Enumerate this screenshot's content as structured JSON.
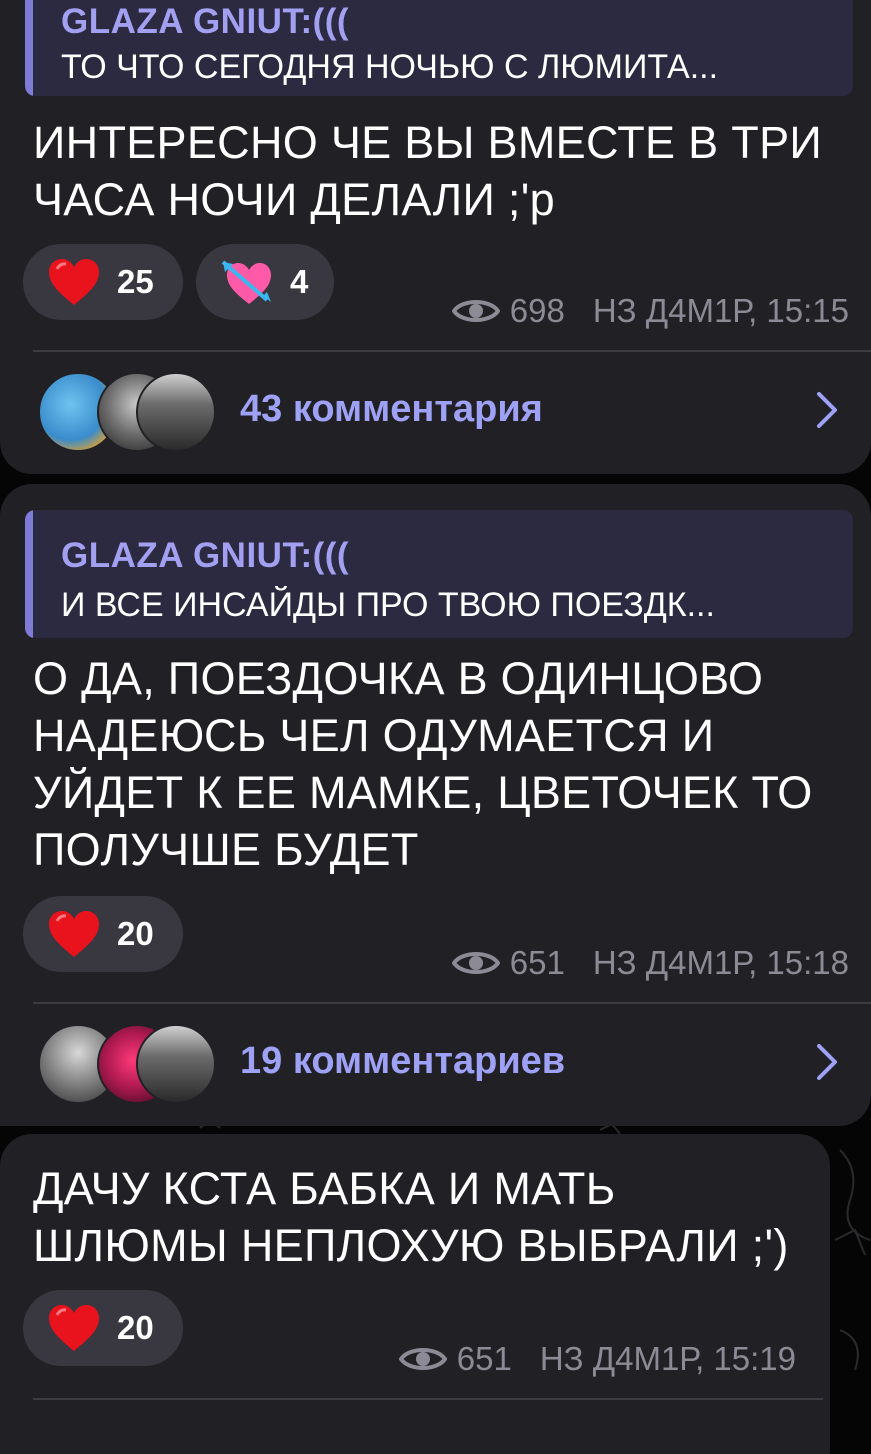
{
  "posts": [
    {
      "quote_author": "GLAZA GNIUT:(((",
      "quote_text": "ТО ЧТО СЕГОДНЯ НОЧЬЮ С ЛЮМИТА...",
      "text": "ИНТЕРЕСНО ЧЕ ВЫ ВМЕСТЕ В ТРИ\nЧАСА НОЧИ ДЕЛАЛИ ;'р",
      "reactions": [
        {
          "icon": "red-heart-icon",
          "count": "25"
        },
        {
          "icon": "heart-with-arrow-icon",
          "count": "4"
        }
      ],
      "views": "698",
      "author_time": "НЗ Д4М1Р, 15:15",
      "comments_label": "43 комментария"
    },
    {
      "quote_author": "GLAZA GNIUT:(((",
      "quote_text": "И ВСЕ ИНСАЙДЫ ПРО ТВОЮ ПОЕЗДК...",
      "text": "О ДА, ПОЕЗДОЧКА В ОДИНЦОВО\nНАДЕЮСЬ ЧЕЛ ОДУМАЕТСЯ И\nУЙДЕТ К ЕЕ МАМКЕ, ЦВЕТОЧЕК ТО\nПОЛУЧШЕ БУДЕТ",
      "reactions": [
        {
          "icon": "red-heart-icon",
          "count": "20"
        }
      ],
      "views": "651",
      "author_time": "НЗ Д4М1Р, 15:18",
      "comments_label": "19 комментариев"
    },
    {
      "text": "ДАЧУ КСТА БАБКА И МАТЬ\nШЛЮМЫ НЕПЛОХУЮ ВЫБРАЛИ ;')",
      "reactions": [
        {
          "icon": "red-heart-icon",
          "count": "20"
        }
      ],
      "views": "651",
      "author_time": "НЗ Д4М1Р, 15:19"
    }
  ],
  "colors": {
    "bubble": "#212125",
    "quote_bg": "#2b2a40",
    "quote_accent": "#7f7cd8",
    "link": "#9fa1f6",
    "meta": "#8c8b95"
  }
}
